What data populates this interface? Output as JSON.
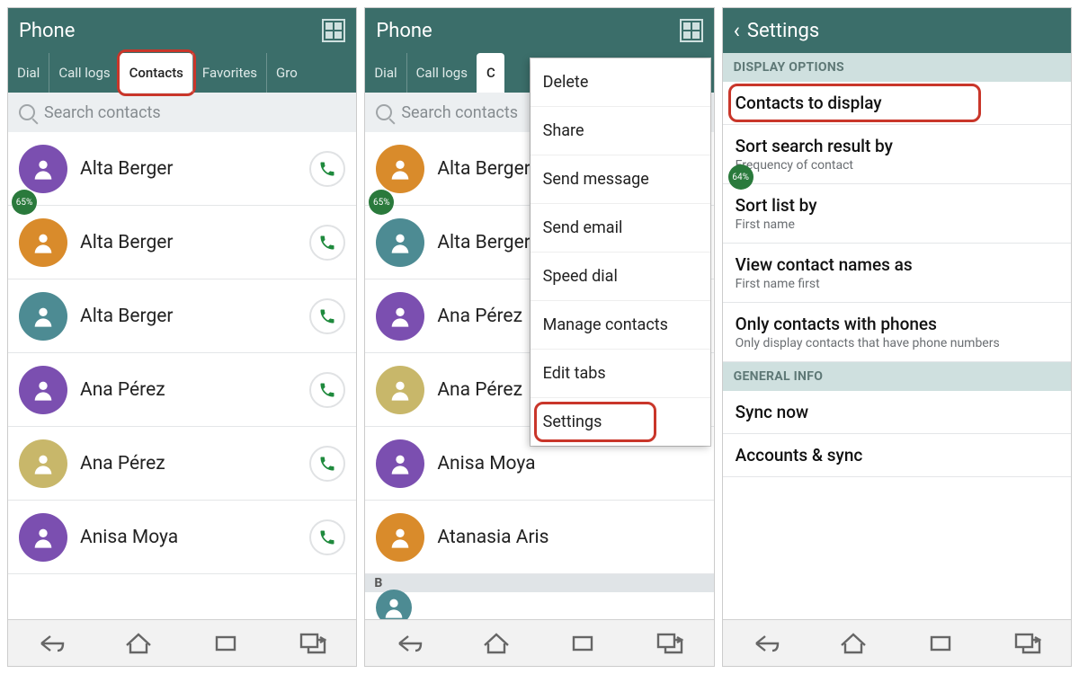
{
  "pane1": {
    "title": "Phone",
    "tabs": [
      "Dial",
      "Call logs",
      "Contacts",
      "Favorites",
      "Gro"
    ],
    "active_tab_index": 2,
    "search_placeholder": "Search contacts",
    "badge": "65%",
    "contacts": [
      {
        "name": "Alta Berger",
        "color": "#7b4fb0"
      },
      {
        "name": "Alta Berger",
        "color": "#d98b2b"
      },
      {
        "name": "Alta Berger",
        "color": "#4d8b93"
      },
      {
        "name": "Ana Pérez",
        "color": "#7b4fb0"
      },
      {
        "name": "Ana Pérez",
        "color": "#c8b76a"
      },
      {
        "name": "Anisa Moya",
        "color": "#7b4fb0"
      }
    ]
  },
  "pane2": {
    "title": "Phone",
    "tabs": [
      "Dial",
      "Call logs",
      "C"
    ],
    "active_tab_index": 2,
    "search_placeholder": "Search contacts",
    "badge": "65%",
    "contacts": [
      {
        "name": "Alta Berger",
        "color": "#d98b2b"
      },
      {
        "name": "Alta Berger",
        "color": "#4d8b93"
      },
      {
        "name": "Ana Pérez",
        "color": "#7b4fb0"
      },
      {
        "name": "Ana Pérez",
        "color": "#c8b76a"
      },
      {
        "name": "Anisa Moya",
        "color": "#7b4fb0"
      },
      {
        "name": "Atanasia Aris",
        "color": "#d98b2b"
      }
    ],
    "section_letter": "B",
    "menu": [
      "Delete",
      "Share",
      "Send message",
      "Send email",
      "Speed dial",
      "Manage contacts",
      "Edit tabs",
      "Settings"
    ],
    "menu_highlight_index": 7
  },
  "pane3": {
    "title": "Settings",
    "badge": "64%",
    "sections": [
      {
        "header": "DISPLAY OPTIONS",
        "items": [
          {
            "title": "Contacts to display",
            "highlight": true
          },
          {
            "title": "Sort search result by",
            "sub": "Frequency of contact"
          },
          {
            "title": "Sort list by",
            "sub": "First name"
          },
          {
            "title": "View contact names as",
            "sub": "First name first"
          },
          {
            "title": "Only contacts with phones",
            "sub": "Only display contacts that have phone numbers"
          }
        ]
      },
      {
        "header": "GENERAL INFO",
        "items": [
          {
            "title": "Sync now"
          },
          {
            "title": "Accounts & sync"
          }
        ]
      }
    ]
  }
}
